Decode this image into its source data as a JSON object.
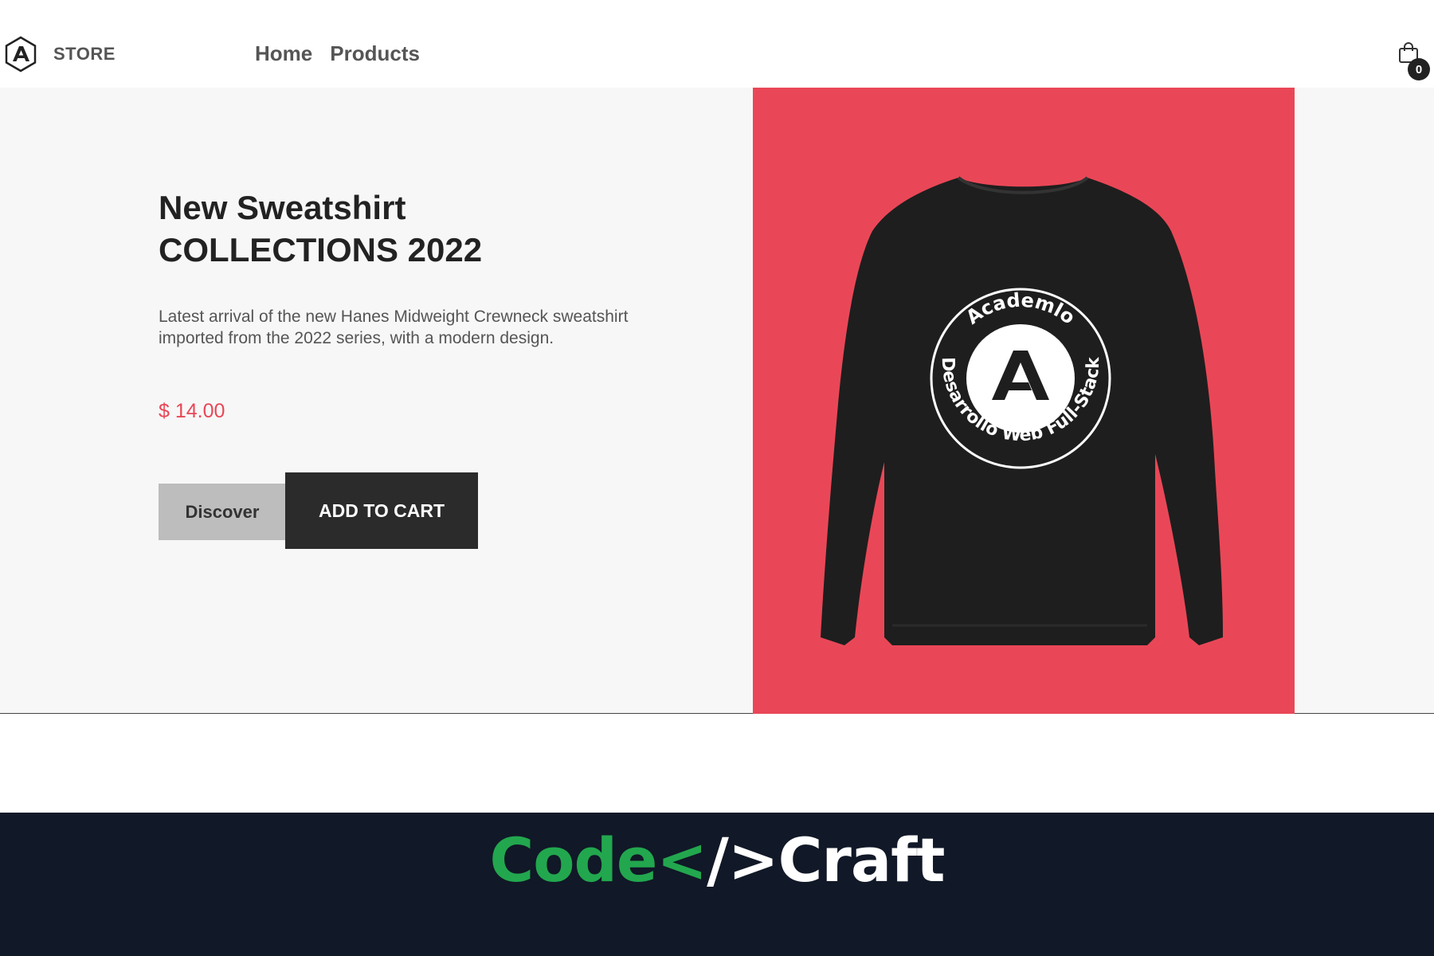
{
  "navbar": {
    "brand_name": "STORE",
    "links": [
      "Home",
      "Products"
    ],
    "cart_count": "0"
  },
  "hero": {
    "title_line1": "New Sweatshirt",
    "title_line2": "COLLECTIONS 2022",
    "description": "Latest arrival of the new Hanes Midweight Crewneck sweatshirt imported from the 2022 series, with a modern design.",
    "price": "$ 14.00",
    "discover_label": "Discover",
    "add_to_cart_label": "ADD TO CART"
  },
  "product_image": {
    "background_color": "#e94757",
    "garment_color": "#1e1e1e",
    "badge_top_text": "Academlo",
    "badge_bottom_text": "Desarrollo Web Full-Stack"
  },
  "footer": {
    "logo_part1": "Code<",
    "logo_part2": "/>",
    "logo_part3": "Craft"
  },
  "colors": {
    "accent": "#e94757",
    "dark": "#2b2b2b",
    "logo_green": "#22a74e",
    "footer_bg": "#111827"
  }
}
